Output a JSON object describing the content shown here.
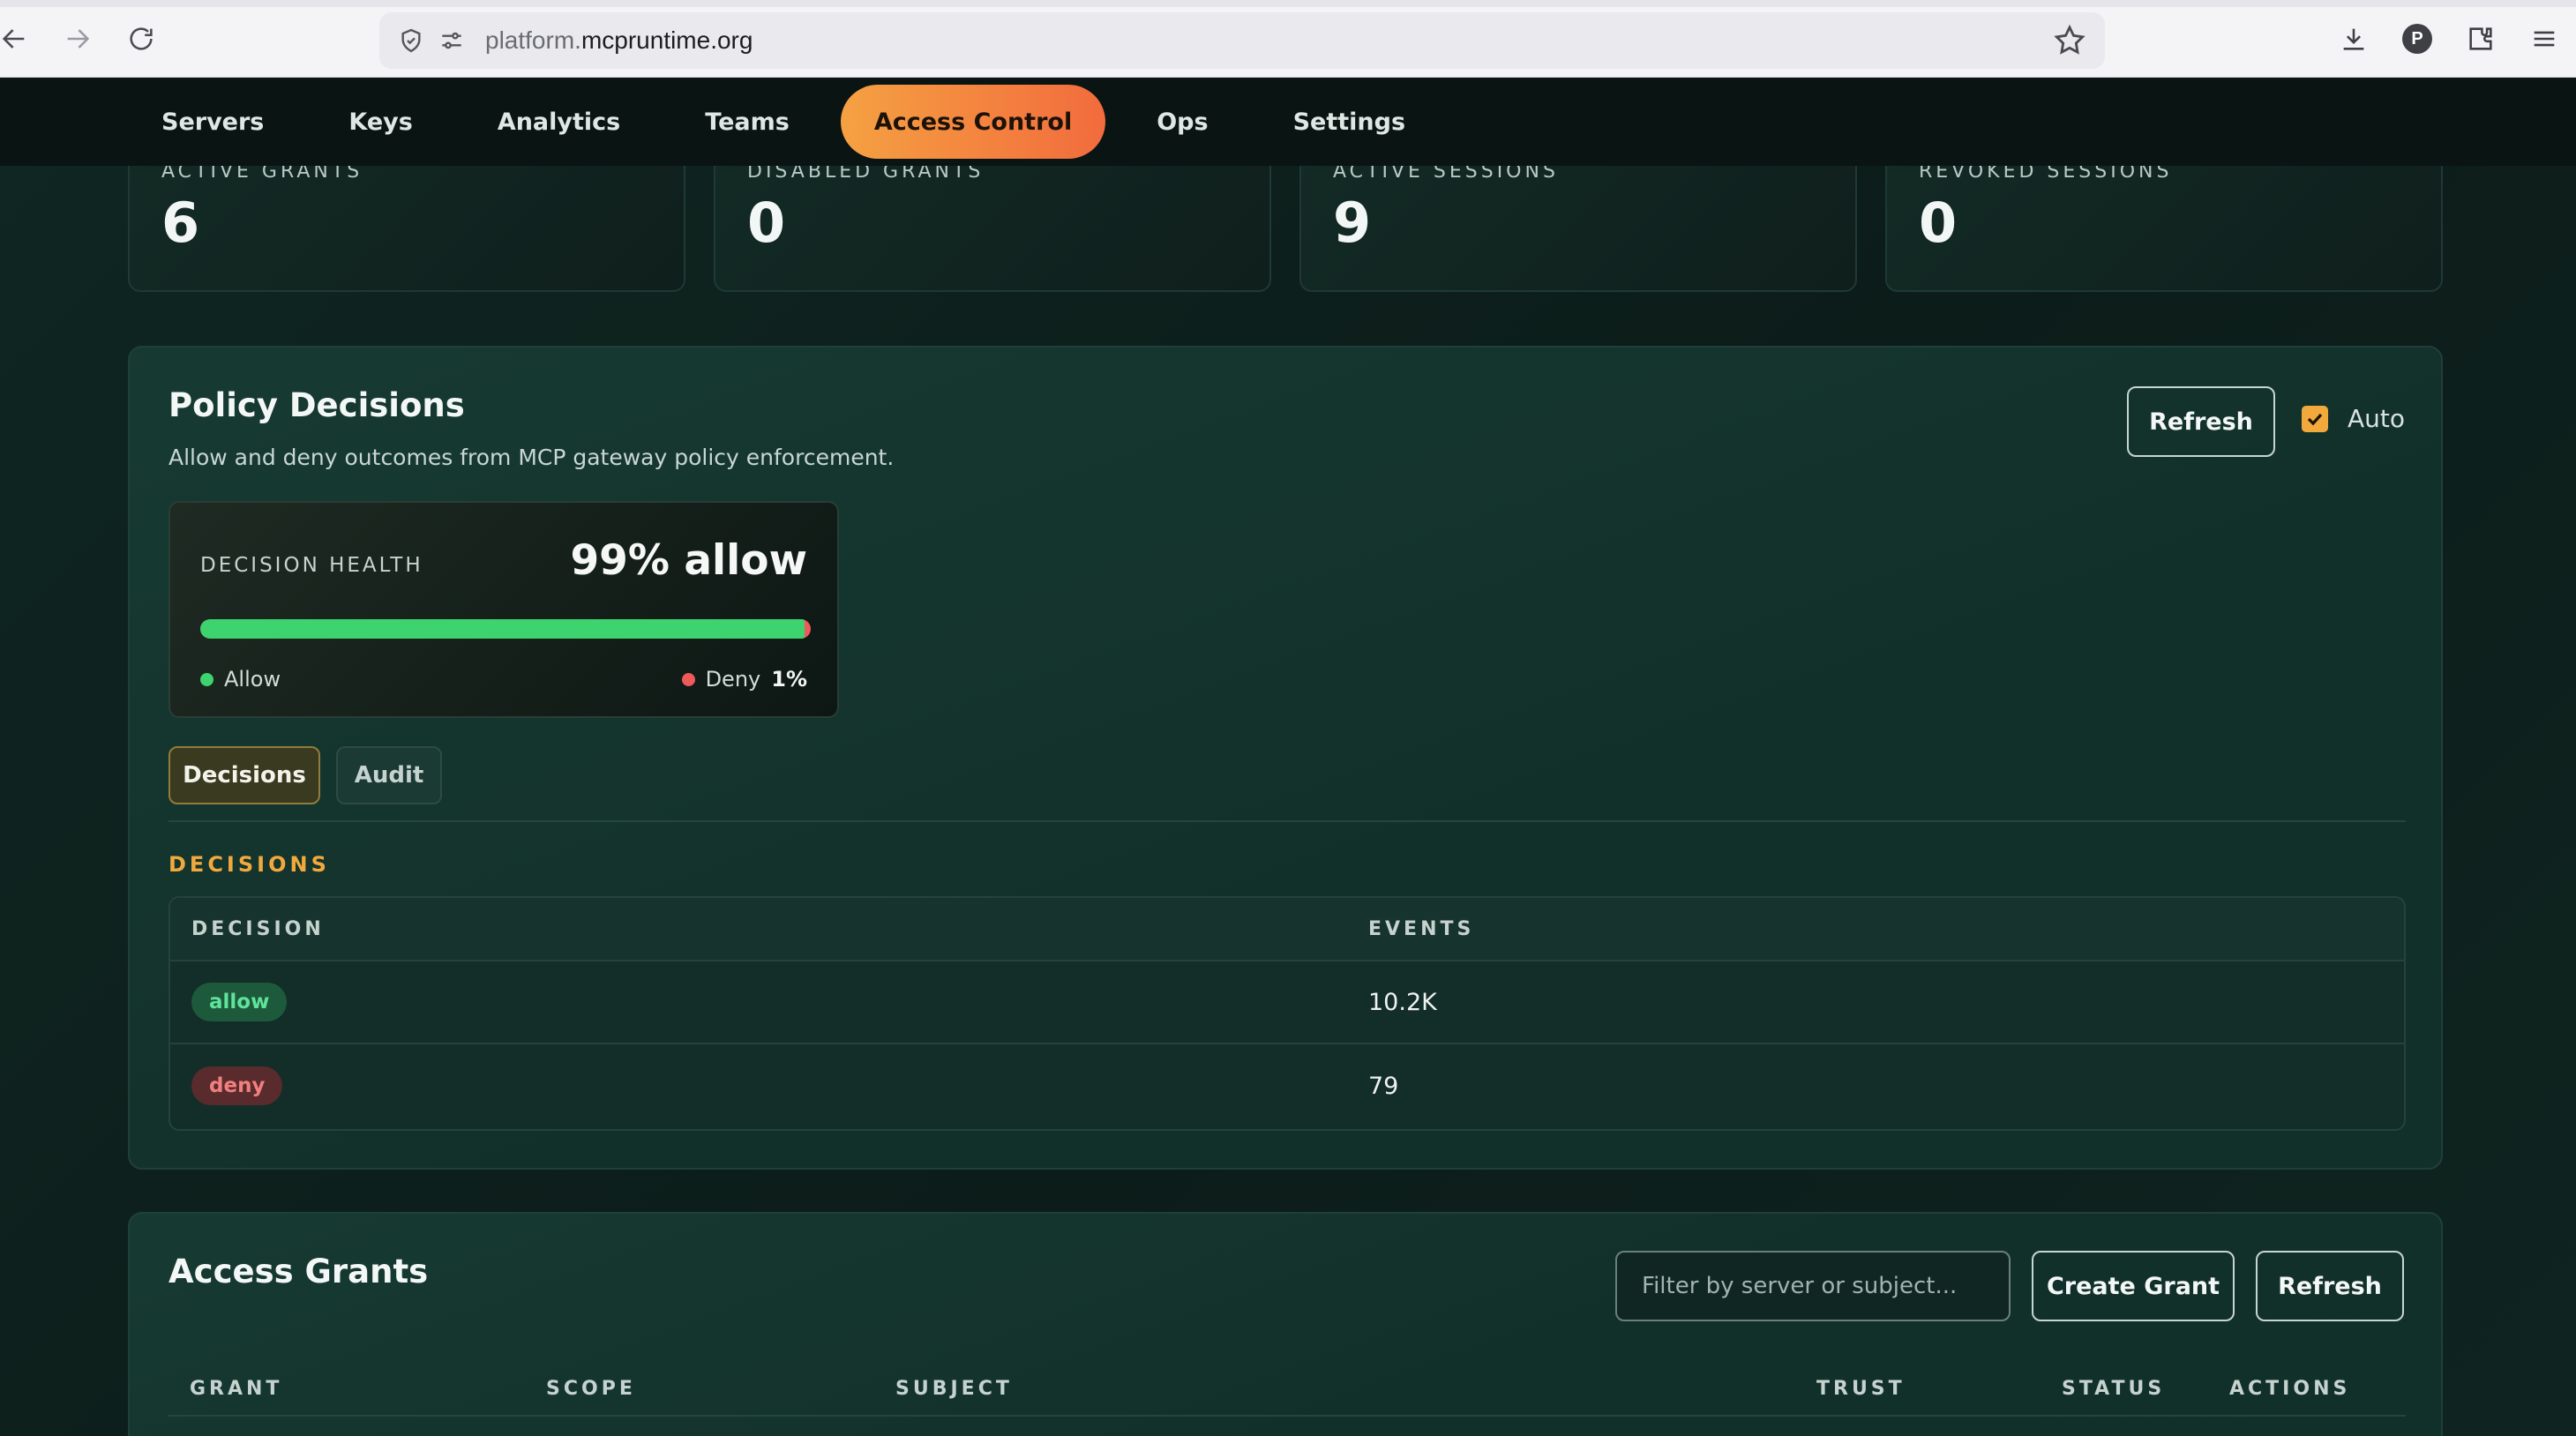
{
  "browser": {
    "url_prefix": "platform.",
    "url_domain": "mcpruntime.org",
    "profile_initial": "P"
  },
  "nav": {
    "items": [
      {
        "label": "Servers",
        "active": false
      },
      {
        "label": "Keys",
        "active": false
      },
      {
        "label": "Analytics",
        "active": false
      },
      {
        "label": "Teams",
        "active": false
      },
      {
        "label": "Access Control",
        "active": true
      },
      {
        "label": "Ops",
        "active": false
      },
      {
        "label": "Settings",
        "active": false
      }
    ]
  },
  "stats": [
    {
      "label": "ACTIVE GRANTS",
      "value": "6"
    },
    {
      "label": "DISABLED GRANTS",
      "value": "0"
    },
    {
      "label": "ACTIVE SESSIONS",
      "value": "9"
    },
    {
      "label": "REVOKED SESSIONS",
      "value": "0"
    }
  ],
  "policy": {
    "title": "Policy Decisions",
    "subtitle": "Allow and deny outcomes from MCP gateway policy enforcement.",
    "refresh_label": "Refresh",
    "auto_label": "Auto",
    "auto_checked": true,
    "health": {
      "label": "DECISION HEALTH",
      "value": "99% allow",
      "allow_fraction": 0.99,
      "allow_label": "Allow",
      "deny_label": "Deny",
      "deny_pct": "1%",
      "allow_color": "#3dd36f",
      "deny_color": "#ee5a5a"
    },
    "tabs": [
      {
        "label": "Decisions",
        "selected": true
      },
      {
        "label": "Audit",
        "selected": false
      }
    ],
    "section_label": "DECISIONS",
    "table": {
      "columns": [
        "DECISION",
        "EVENTS"
      ],
      "rows": [
        {
          "decision": "allow",
          "events": "10.2K"
        },
        {
          "decision": "deny",
          "events": "79"
        }
      ]
    }
  },
  "grants": {
    "title": "Access Grants",
    "filter_placeholder": "Filter by server or subject...",
    "create_label": "Create Grant",
    "refresh_label": "Refresh",
    "columns": [
      "GRANT",
      "SCOPE",
      "SUBJECT",
      "TRUST",
      "STATUS",
      "ACTIONS"
    ]
  },
  "colors": {
    "accent": "#f2a93b",
    "nav_active_start": "#f5a142",
    "nav_active_end": "#f26b3d"
  }
}
